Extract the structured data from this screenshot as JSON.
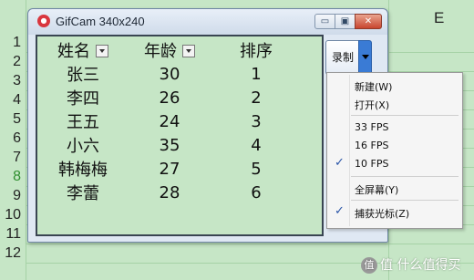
{
  "sheet": {
    "column_label": "E",
    "row_numbers": [
      "1",
      "2",
      "3",
      "4",
      "5",
      "6",
      "7",
      "8",
      "9",
      "10",
      "11",
      "12"
    ],
    "active_row": "8",
    "colors": {
      "background": "#c6e6c6",
      "gridline": "#a6d2a6",
      "active_row_number": "#2f8f2f"
    }
  },
  "window": {
    "title": "GifCam 340x240",
    "app_icon": "gifcam-logo-icon",
    "minimize_glyph": "▭",
    "maximize_glyph": "▣",
    "close_glyph": "✕"
  },
  "table": {
    "headers": [
      "姓名",
      "年龄",
      "排序"
    ],
    "rows": [
      [
        "张三",
        "30",
        "1"
      ],
      [
        "李四",
        "26",
        "2"
      ],
      [
        "王五",
        "24",
        "3"
      ],
      [
        "小六",
        "35",
        "4"
      ],
      [
        "韩梅梅",
        "27",
        "5"
      ],
      [
        "李蕾",
        "28",
        "6"
      ]
    ]
  },
  "record": {
    "label": "录制",
    "dropdown_icon": "chevron-down-icon",
    "accent": "#3a7bd5"
  },
  "menu": {
    "new": "新建(W)",
    "open": "打开(X)",
    "fps33": "33 FPS",
    "fps16": "16 FPS",
    "fps10": "10 FPS",
    "fullscreen": "全屏幕(Y)",
    "capture_cursor": "捕获光标(Z)",
    "checked": [
      "10 FPS",
      "捕获光标(Z)"
    ],
    "check_glyph": "✓"
  },
  "watermark": {
    "text": "值 什么值得买",
    "logo": "值"
  }
}
